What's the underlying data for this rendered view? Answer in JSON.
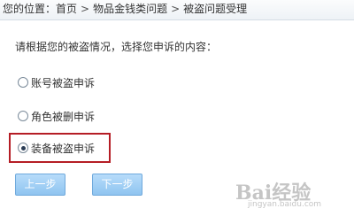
{
  "breadcrumb": {
    "prefix": "您的位置：",
    "items": [
      "首页",
      "物品金钱类问题",
      "被盗问题受理"
    ],
    "separator": ">"
  },
  "prompt": "请根据您的被盗情况，选择您申诉的内容：",
  "options": [
    {
      "label": "账号被盗申诉",
      "selected": false
    },
    {
      "label": "角色被删申诉",
      "selected": false
    },
    {
      "label": "装备被盗申诉",
      "selected": true
    }
  ],
  "buttons": {
    "prev": "上一步",
    "next": "下一步"
  },
  "watermark": {
    "logo_text": "Bai经验",
    "sub_text": "jingyan.baidu.com"
  },
  "colors": {
    "highlight_border": "#b51d25",
    "button_fill": "#9fcdf4",
    "crumb_bar": "#f2f5f8"
  }
}
